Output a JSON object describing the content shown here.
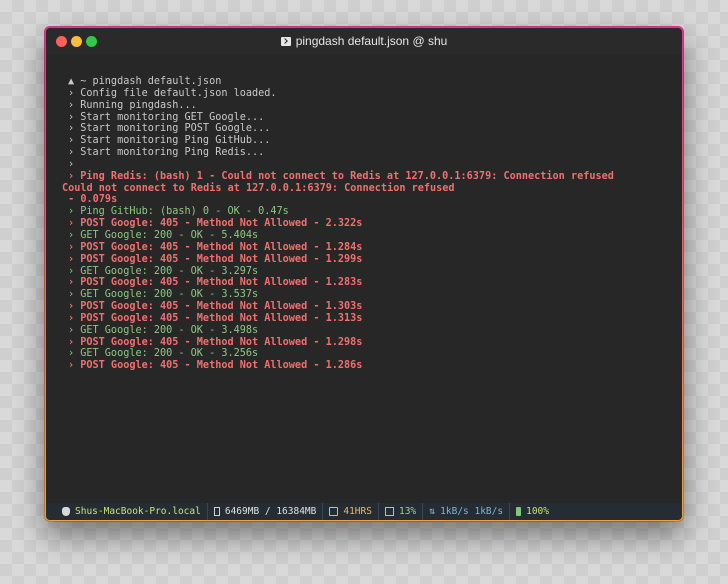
{
  "window": {
    "title": "pingdash default.json @ shu"
  },
  "console": {
    "lines": [
      {
        "text": "▲ ~ pingdash default.json",
        "kind": "plain",
        "indent": true
      },
      {
        "text": "› Config file default.json loaded.",
        "kind": "plain",
        "indent": true
      },
      {
        "text": "› Running pingdash...",
        "kind": "plain",
        "indent": true
      },
      {
        "text": "› Start monitoring GET Google...",
        "kind": "plain",
        "indent": true
      },
      {
        "text": "› Start monitoring POST Google...",
        "kind": "plain",
        "indent": true
      },
      {
        "text": "› Start monitoring Ping GitHub...",
        "kind": "plain",
        "indent": true
      },
      {
        "text": "› Start monitoring Ping Redis...",
        "kind": "plain",
        "indent": true
      },
      {
        "text": "›",
        "kind": "plain",
        "indent": true
      },
      {
        "text": "› Ping Redis: (bash) 1 - Could not connect to Redis at 127.0.0.1:6379: Connection refused",
        "kind": "err",
        "indent": true
      },
      {
        "text": "Could not connect to Redis at 127.0.0.1:6379: Connection refused",
        "kind": "err",
        "indent": false
      },
      {
        "text": " - 0.079s",
        "kind": "err",
        "indent": false
      },
      {
        "text": "› Ping GitHub: (bash) 0 - OK - 0.47s",
        "kind": "ok",
        "indent": true
      },
      {
        "text": "› POST Google: 405 - Method Not Allowed - 2.322s",
        "kind": "warn",
        "indent": true
      },
      {
        "text": "› GET Google: 200 - OK - 5.404s",
        "kind": "ok",
        "indent": true
      },
      {
        "text": "› POST Google: 405 - Method Not Allowed - 1.284s",
        "kind": "warn",
        "indent": true
      },
      {
        "text": "› POST Google: 405 - Method Not Allowed - 1.299s",
        "kind": "warn",
        "indent": true
      },
      {
        "text": "› GET Google: 200 - OK - 3.297s",
        "kind": "ok",
        "indent": true
      },
      {
        "text": "› POST Google: 405 - Method Not Allowed - 1.283s",
        "kind": "warn",
        "indent": true
      },
      {
        "text": "› GET Google: 200 - OK - 3.537s",
        "kind": "ok",
        "indent": true
      },
      {
        "text": "› POST Google: 405 - Method Not Allowed - 1.303s",
        "kind": "warn",
        "indent": true
      },
      {
        "text": "› POST Google: 405 - Method Not Allowed - 1.313s",
        "kind": "warn",
        "indent": true
      },
      {
        "text": "› GET Google: 200 - OK - 3.498s",
        "kind": "ok",
        "indent": true
      },
      {
        "text": "› POST Google: 405 - Method Not Allowed - 1.298s",
        "kind": "warn",
        "indent": true
      },
      {
        "text": "› GET Google: 200 - OK - 3.256s",
        "kind": "ok",
        "indent": true
      },
      {
        "text": "› POST Google: 405 - Method Not Allowed - 1.286s",
        "kind": "warn",
        "indent": true
      }
    ]
  },
  "statusbar": {
    "host": "Shus-MacBook-Pro.local",
    "memory": "6469MB / 16384MB",
    "uptime": "41HRS",
    "cpu": "13%",
    "network": "1kB/s 1kB/s",
    "battery": "100%"
  },
  "icons": {
    "host": "apple-icon",
    "memory": "memory-icon",
    "uptime": "clock-icon",
    "cpu": "cpu-icon",
    "network": "network-arrows-icon",
    "battery": "battery-icon"
  },
  "colors": {
    "error": "#f0706e",
    "ok": "#8fc782",
    "border_top": "#e0358b",
    "border_bottom": "#f0a23c"
  }
}
